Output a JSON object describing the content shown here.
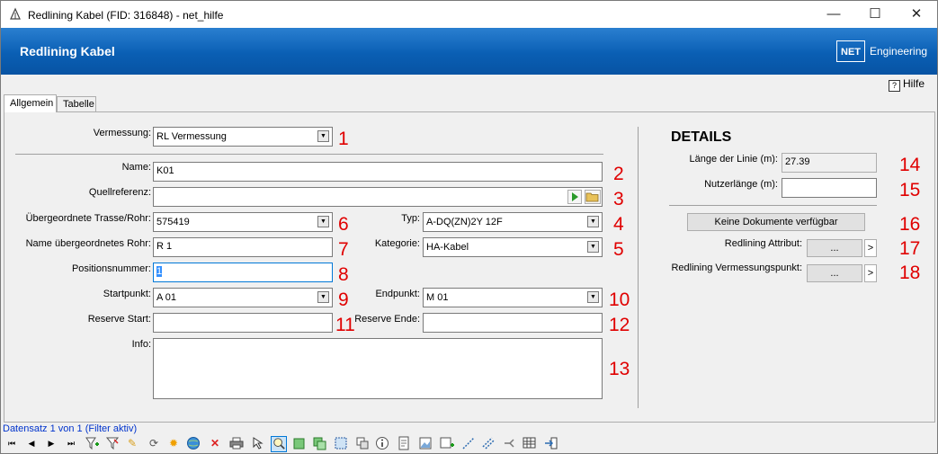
{
  "window": {
    "title": "Redlining Kabel (FID: 316848) - net_hilfe",
    "controls": {
      "minimize": "—",
      "maximize": "☐",
      "close": "✕"
    }
  },
  "banner": {
    "title": "Redlining Kabel",
    "logo_box": "NET",
    "logo_text": "Engineering"
  },
  "help": {
    "label": "Hilfe"
  },
  "tabs": [
    {
      "label": "Allgemein"
    },
    {
      "label": "Tabelle"
    }
  ],
  "form": {
    "vermessung": {
      "label": "Vermessung:",
      "value": "RL Vermessung",
      "marker": "1"
    },
    "name": {
      "label": "Name:",
      "value": "K01",
      "marker": "2"
    },
    "quellreferenz": {
      "label": "Quellreferenz:",
      "value": "",
      "marker": "3"
    },
    "trasse": {
      "label": "Übergeordnete Trasse/Rohr:",
      "value": "575419",
      "marker": "6"
    },
    "typ": {
      "label": "Typ:",
      "value": "A-DQ(ZN)2Y 12F",
      "marker": "4"
    },
    "rohr_name": {
      "label": "Name übergeordnetes Rohr:",
      "value": "R 1",
      "marker": "7"
    },
    "kategorie": {
      "label": "Kategorie:",
      "value": "HA-Kabel",
      "marker": "5"
    },
    "positionsnummer": {
      "label": "Positionsnummer:",
      "value": "1",
      "marker": "8"
    },
    "startpunkt": {
      "label": "Startpunkt:",
      "value": "A 01",
      "marker": "9"
    },
    "endpunkt": {
      "label": "Endpunkt:",
      "value": "M 01",
      "marker": "10"
    },
    "reserve_start": {
      "label": "Reserve Start:",
      "value": "",
      "marker": "11"
    },
    "reserve_ende": {
      "label": "Reserve Ende:",
      "value": "",
      "marker": "12"
    },
    "info": {
      "label": "Info:",
      "value": "",
      "marker": "13"
    }
  },
  "details": {
    "heading": "DETAILS",
    "laenge": {
      "label": "Länge der Linie (m):",
      "value": "27.39",
      "marker": "14"
    },
    "nutzerlaenge": {
      "label": "Nutzerlänge (m):",
      "value": "",
      "marker": "15"
    },
    "dokumente": {
      "label": "Keine Dokumente verfügbar",
      "marker": "16"
    },
    "attribut": {
      "label": "Redlining Attribut:",
      "button": "...",
      "arrow": ">",
      "marker": "17"
    },
    "vermessungspunkt": {
      "label": "Redlining Vermessungspunkt:",
      "button": "...",
      "arrow": ">",
      "marker": "18"
    }
  },
  "status": {
    "text": "Datensatz 1 von 1 (Filter aktiv)"
  },
  "toolbar": {
    "icons": [
      "first-record-icon",
      "previous-record-icon",
      "next-record-icon",
      "last-record-icon",
      "add-filter-icon",
      "filter-icon",
      "edit-icon",
      "refresh-icon",
      "highlight-icon",
      "globe-icon",
      "delete-icon",
      "print-icon",
      "select-icon",
      "zoom-icon",
      "area-icon",
      "area-add-icon",
      "select-box-icon",
      "copy-icon",
      "info-icon",
      "report-icon",
      "image-icon",
      "image-add-icon",
      "line-icon",
      "line-split-icon",
      "route-icon",
      "table-icon",
      "exit-icon"
    ]
  },
  "colors": {
    "banner": "#0a5fb4",
    "marker": "#e00000",
    "status_text": "#0033cc"
  }
}
